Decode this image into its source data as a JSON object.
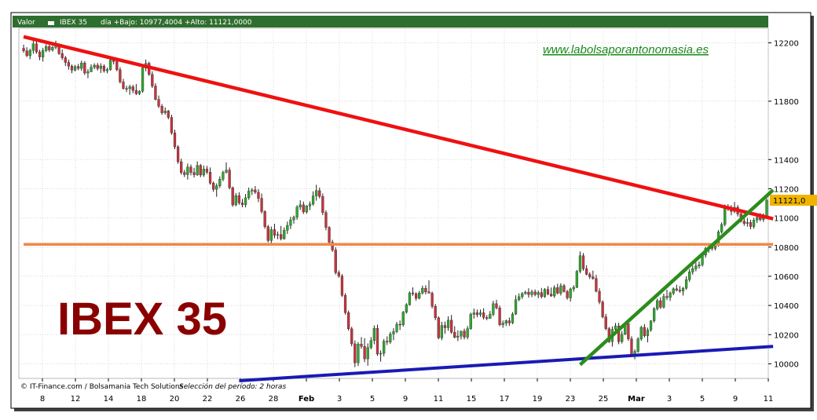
{
  "header": {
    "symbol_label": "Valor",
    "symbol": "IBEX 35",
    "ohlc_text": "día +Bajo: 10977,4004 +Alto: 11121,0000"
  },
  "watermark": "www.labolsaporantonomasia.es",
  "big_title": "IBEX 35",
  "footer": {
    "credit": "© IT-Finance.com / Bolsamania Tech Solutions",
    "period": "Selección del período: 2 horas"
  },
  "colors": {
    "header_bg": "#2e6e2e",
    "up": "#2fa82f",
    "down": "#c8323c",
    "resistance": "#ee1111",
    "support_h": "#f08848",
    "support_low": "#1a1ab4",
    "uptrend": "#2c8c1c",
    "last_tag": "#f0b400"
  },
  "chart_data": {
    "type": "candlestick",
    "ylim": [
      9900,
      12300
    ],
    "y_ticks": [
      10000,
      10200,
      10400,
      10600,
      10800,
      11000,
      11200,
      11400,
      11800,
      12200
    ],
    "x_tick_labels": [
      "8",
      "12",
      "14",
      "18",
      "20",
      "22",
      "26",
      "28",
      "Feb",
      "3",
      "5",
      "9",
      "11",
      "15",
      "17",
      "19",
      "23",
      "25",
      "Mar",
      "3",
      "5",
      "9",
      "11"
    ],
    "last_price_label": "11121,0",
    "last_value": 11121,
    "grid": true,
    "legend": "none",
    "ohlc": [
      [
        12163,
        12188,
        12132,
        12145
      ],
      [
        12145,
        12170,
        12102,
        12112
      ],
      [
        12112,
        12160,
        12088,
        12148
      ],
      [
        12148,
        12214,
        12125,
        12193
      ],
      [
        12193,
        12212,
        12126,
        12138
      ],
      [
        12138,
        12152,
        12081,
        12103
      ],
      [
        12103,
        12165,
        12072,
        12147
      ],
      [
        12147,
        12191,
        12136,
        12175
      ],
      [
        12175,
        12200,
        12137,
        12151
      ],
      [
        12151,
        12180,
        12140,
        12169
      ],
      [
        12169,
        12215,
        12156,
        12181
      ],
      [
        12181,
        12196,
        12117,
        12127
      ],
      [
        12127,
        12154,
        12083,
        12098
      ],
      [
        12098,
        12111,
        12042,
        12066
      ],
      [
        12066,
        12085,
        12016,
        12040
      ],
      [
        12040,
        12052,
        11992,
        12013
      ],
      [
        12013,
        12049,
        12005,
        12038
      ],
      [
        12038,
        12056,
        12012,
        12025
      ],
      [
        12025,
        12078,
        12008,
        12062
      ],
      [
        12062,
        12075,
        11980,
        11993
      ],
      [
        11993,
        12020,
        11958,
        12002
      ],
      [
        12002,
        12053,
        11999,
        12033
      ],
      [
        12033,
        12060,
        12020,
        12047
      ],
      [
        12047,
        12062,
        12010,
        12024
      ],
      [
        12024,
        12060,
        11993,
        12041
      ],
      [
        12041,
        12052,
        11996,
        12008
      ],
      [
        12008,
        12030,
        11991,
        12017
      ],
      [
        12017,
        12106,
        12008,
        12082
      ],
      [
        12082,
        12101,
        12052,
        12072
      ],
      [
        12072,
        12093,
        12005,
        12016
      ],
      [
        12016,
        12033,
        11922,
        11932
      ],
      [
        11932,
        11953,
        11880,
        11887
      ],
      [
        11887,
        11906,
        11863,
        11886
      ],
      [
        11886,
        11913,
        11844,
        11899
      ],
      [
        11899,
        11912,
        11855,
        11874
      ],
      [
        11874,
        11918,
        11842,
        11851
      ],
      [
        11851,
        11876,
        11842,
        11869
      ],
      [
        11869,
        12036,
        11858,
        12028
      ],
      [
        12028,
        12086,
        12005,
        12060
      ],
      [
        12060,
        12071,
        11974,
        11984
      ],
      [
        11984,
        12005,
        11891,
        11904
      ],
      [
        11904,
        11923,
        11806,
        11812
      ],
      [
        11812,
        11839,
        11753,
        11766
      ],
      [
        11766,
        11781,
        11706,
        11721
      ],
      [
        11721,
        11757,
        11708,
        11733
      ],
      [
        11733,
        11740,
        11676,
        11689
      ],
      [
        11689,
        11707,
        11570,
        11583
      ],
      [
        11583,
        11605,
        11471,
        11487
      ],
      [
        11487,
        11499,
        11371,
        11385
      ],
      [
        11385,
        11406,
        11296,
        11311
      ],
      [
        11311,
        11329,
        11280,
        11297
      ],
      [
        11297,
        11373,
        11263,
        11349
      ],
      [
        11349,
        11366,
        11292,
        11312
      ],
      [
        11312,
        11343,
        11277,
        11296
      ],
      [
        11296,
        11387,
        11288,
        11360
      ],
      [
        11360,
        11370,
        11279,
        11294
      ],
      [
        11294,
        11359,
        11281,
        11335
      ],
      [
        11335,
        11356,
        11301,
        11314
      ],
      [
        11314,
        11346,
        11228,
        11239
      ],
      [
        11239,
        11250,
        11179,
        11196
      ],
      [
        11196,
        11237,
        11145,
        11220
      ],
      [
        11220,
        11285,
        11206,
        11266
      ],
      [
        11266,
        11324,
        11251,
        11312
      ],
      [
        11312,
        11381,
        11305,
        11328
      ],
      [
        11328,
        11346,
        11196,
        11207
      ],
      [
        11207,
        11215,
        11076,
        11089
      ],
      [
        11089,
        11171,
        11080,
        11153
      ],
      [
        11153,
        11176,
        11090,
        11103
      ],
      [
        11103,
        11130,
        11073,
        11090
      ],
      [
        11090,
        11164,
        11072,
        11138
      ],
      [
        11138,
        11208,
        11124,
        11184
      ],
      [
        11184,
        11204,
        11157,
        11192
      ],
      [
        11192,
        11218,
        11164,
        11176
      ],
      [
        11176,
        11197,
        11108,
        11134
      ],
      [
        11134,
        11167,
        11030,
        11044
      ],
      [
        11044,
        11052,
        10926,
        10940
      ],
      [
        10940,
        10952,
        10832,
        10845
      ],
      [
        10845,
        10941,
        10828,
        10920
      ],
      [
        10920,
        10960,
        10861,
        10881
      ],
      [
        10881,
        10907,
        10854,
        10886
      ],
      [
        10886,
        10945,
        10846,
        10857
      ],
      [
        10857,
        10935,
        10851,
        10915
      ],
      [
        10915,
        10975,
        10890,
        10949
      ],
      [
        10949,
        11008,
        10924,
        10987
      ],
      [
        10987,
        11016,
        10961,
        11005
      ],
      [
        11005,
        11087,
        10987,
        11074
      ],
      [
        11074,
        11121,
        11054,
        11090
      ],
      [
        11090,
        11112,
        11027,
        11041
      ],
      [
        11041,
        11087,
        11029,
        11082
      ],
      [
        11082,
        11113,
        11053,
        11095
      ],
      [
        11095,
        11182,
        11084,
        11151
      ],
      [
        11151,
        11227,
        11118,
        11187
      ],
      [
        11187,
        11208,
        11134,
        11147
      ],
      [
        11147,
        11167,
        11019,
        11037
      ],
      [
        11037,
        11052,
        10915,
        10935
      ],
      [
        10935,
        10944,
        10820,
        10833
      ],
      [
        10833,
        10850,
        10767,
        10780
      ],
      [
        10780,
        10799,
        10612,
        10625
      ],
      [
        10625,
        10640,
        10590,
        10602
      ],
      [
        10602,
        10615,
        10458,
        10469
      ],
      [
        10469,
        10484,
        10337,
        10351
      ],
      [
        10351,
        10365,
        10227,
        10240
      ],
      [
        10240,
        10254,
        10120,
        10137
      ],
      [
        10137,
        10160,
        9977,
        10007
      ],
      [
        10007,
        10149,
        9985,
        10135
      ],
      [
        10135,
        10183,
        10103,
        10119
      ],
      [
        10119,
        10176,
        10011,
        10034
      ],
      [
        10034,
        10140,
        9987,
        10111
      ],
      [
        10111,
        10183,
        10099,
        10159
      ],
      [
        10159,
        10263,
        10134,
        10243
      ],
      [
        10243,
        10269,
        10054,
        10067
      ],
      [
        10067,
        10092,
        10015,
        10072
      ],
      [
        10072,
        10170,
        10051,
        10155
      ],
      [
        10155,
        10188,
        10129,
        10150
      ],
      [
        10150,
        10219,
        10137,
        10204
      ],
      [
        10204,
        10244,
        10162,
        10221
      ],
      [
        10221,
        10287,
        10210,
        10271
      ],
      [
        10271,
        10297,
        10232,
        10267
      ],
      [
        10267,
        10362,
        10255,
        10354
      ],
      [
        10354,
        10416,
        10344,
        10405
      ],
      [
        10405,
        10496,
        10399,
        10486
      ],
      [
        10486,
        10524,
        10466,
        10480
      ],
      [
        10480,
        10491,
        10433,
        10449
      ],
      [
        10449,
        10500,
        10442,
        10485
      ],
      [
        10485,
        10536,
        10475,
        10518
      ],
      [
        10518,
        10539,
        10476,
        10493
      ],
      [
        10493,
        10572,
        10482,
        10484
      ],
      [
        10484,
        10495,
        10380,
        10394
      ],
      [
        10394,
        10410,
        10299,
        10315
      ],
      [
        10315,
        10325,
        10169,
        10178
      ],
      [
        10178,
        10288,
        10162,
        10263
      ],
      [
        10263,
        10289,
        10206,
        10247
      ],
      [
        10247,
        10326,
        10227,
        10299
      ],
      [
        10299,
        10335,
        10205,
        10216
      ],
      [
        10216,
        10258,
        10174,
        10182
      ],
      [
        10182,
        10229,
        10156,
        10190
      ],
      [
        10190,
        10227,
        10167,
        10224
      ],
      [
        10224,
        10241,
        10167,
        10183
      ],
      [
        10183,
        10259,
        10168,
        10241
      ],
      [
        10241,
        10351,
        10234,
        10339
      ],
      [
        10339,
        10378,
        10310,
        10350
      ],
      [
        10350,
        10372,
        10319,
        10337
      ],
      [
        10337,
        10372,
        10322,
        10350
      ],
      [
        10350,
        10381,
        10303,
        10317
      ],
      [
        10317,
        10334,
        10299,
        10311
      ],
      [
        10311,
        10362,
        10309,
        10339
      ],
      [
        10339,
        10432,
        10326,
        10412
      ],
      [
        10412,
        10439,
        10373,
        10383
      ],
      [
        10383,
        10399,
        10258,
        10268
      ],
      [
        10268,
        10297,
        10247,
        10278
      ],
      [
        10278,
        10303,
        10259,
        10295
      ],
      [
        10295,
        10317,
        10260,
        10280
      ],
      [
        10280,
        10354,
        10272,
        10341
      ],
      [
        10341,
        10470,
        10334,
        10440
      ],
      [
        10440,
        10483,
        10429,
        10460
      ],
      [
        10460,
        10492,
        10445,
        10481
      ],
      [
        10481,
        10502,
        10474,
        10491
      ],
      [
        10491,
        10518,
        10453,
        10474
      ],
      [
        10474,
        10508,
        10457,
        10493
      ],
      [
        10493,
        10510,
        10463,
        10475
      ],
      [
        10475,
        10502,
        10450,
        10488
      ],
      [
        10488,
        10520,
        10449,
        10460
      ],
      [
        10460,
        10519,
        10452,
        10510
      ],
      [
        10510,
        10532,
        10470,
        10478
      ],
      [
        10478,
        10523,
        10459,
        10465
      ],
      [
        10465,
        10538,
        10452,
        10522
      ],
      [
        10522,
        10549,
        10476,
        10484
      ],
      [
        10484,
        10552,
        10468,
        10535
      ],
      [
        10535,
        10547,
        10489,
        10495
      ],
      [
        10495,
        10507,
        10439,
        10452
      ],
      [
        10452,
        10522,
        10427,
        10513
      ],
      [
        10513,
        10539,
        10494,
        10524
      ],
      [
        10524,
        10643,
        10519,
        10634
      ],
      [
        10634,
        10770,
        10620,
        10741
      ],
      [
        10741,
        10759,
        10638,
        10651
      ],
      [
        10651,
        10675,
        10607,
        10613
      ],
      [
        10613,
        10627,
        10581,
        10596
      ],
      [
        10596,
        10639,
        10576,
        10585
      ],
      [
        10585,
        10610,
        10490,
        10497
      ],
      [
        10497,
        10518,
        10409,
        10424
      ],
      [
        10424,
        10435,
        10312,
        10322
      ],
      [
        10322,
        10342,
        10230,
        10241
      ],
      [
        10241,
        10253,
        10142,
        10152
      ],
      [
        10152,
        10256,
        10118,
        10236
      ],
      [
        10236,
        10280,
        10217,
        10260
      ],
      [
        10260,
        10281,
        10134,
        10152
      ],
      [
        10152,
        10225,
        10139,
        10203
      ],
      [
        10203,
        10287,
        10196,
        10276
      ],
      [
        10276,
        10290,
        10157,
        10171
      ],
      [
        10171,
        10189,
        10049,
        10062
      ],
      [
        10062,
        10099,
        10031,
        10085
      ],
      [
        10085,
        10182,
        10075,
        10170
      ],
      [
        10170,
        10261,
        10157,
        10250
      ],
      [
        10250,
        10272,
        10180,
        10192
      ],
      [
        10192,
        10248,
        10147,
        10232
      ],
      [
        10232,
        10299,
        10220,
        10294
      ],
      [
        10294,
        10389,
        10282,
        10378
      ],
      [
        10378,
        10447,
        10365,
        10433
      ],
      [
        10433,
        10456,
        10376,
        10388
      ],
      [
        10388,
        10481,
        10378,
        10462
      ],
      [
        10462,
        10508,
        10437,
        10454
      ],
      [
        10454,
        10496,
        10431,
        10484
      ],
      [
        10484,
        10524,
        10470,
        10514
      ],
      [
        10514,
        10542,
        10496,
        10505
      ],
      [
        10505,
        10533,
        10487,
        10498
      ],
      [
        10498,
        10527,
        10468,
        10518
      ],
      [
        10518,
        10600,
        10508,
        10577
      ],
      [
        10577,
        10649,
        10561,
        10630
      ],
      [
        10630,
        10674,
        10611,
        10652
      ],
      [
        10652,
        10695,
        10634,
        10671
      ],
      [
        10671,
        10701,
        10653,
        10679
      ],
      [
        10679,
        10755,
        10666,
        10745
      ],
      [
        10745,
        10803,
        10727,
        10791
      ],
      [
        10791,
        10815,
        10761,
        10802
      ],
      [
        10802,
        10823,
        10775,
        10791
      ],
      [
        10791,
        10831,
        10777,
        10813
      ],
      [
        10813,
        10917,
        10803,
        10904
      ],
      [
        10904,
        10970,
        10893,
        10955
      ],
      [
        10955,
        11092,
        10942,
        11070
      ],
      [
        11070,
        11094,
        11048,
        11072
      ],
      [
        11072,
        11088,
        11018,
        11044
      ],
      [
        11044,
        11109,
        11032,
        11073
      ],
      [
        11073,
        11088,
        11010,
        11027
      ],
      [
        11027,
        11045,
        10969,
        10978
      ],
      [
        10978,
        11001,
        10946,
        10962
      ],
      [
        10962,
        11000,
        10940,
        10969
      ],
      [
        10969,
        10987,
        10922,
        10941
      ],
      [
        10941,
        11001,
        10926,
        10985
      ],
      [
        10985,
        11020,
        10965,
        11004
      ],
      [
        11004,
        11033,
        10977,
        10989
      ],
      [
        10989,
        11031,
        10973,
        11006
      ],
      [
        11006,
        11133,
        10994,
        11121
      ]
    ],
    "trend_lines": [
      {
        "name": "resistance",
        "points": [
          [
            0,
            12242
          ],
          [
            233,
            10994
          ]
        ]
      },
      {
        "name": "horizontal-support",
        "points": [
          [
            0,
            10819
          ],
          [
            233,
            10819
          ]
        ]
      },
      {
        "name": "long-term-support",
        "points": [
          [
            67,
            9884
          ],
          [
            233,
            10119
          ]
        ]
      },
      {
        "name": "uptrend",
        "points": [
          [
            173,
            9994
          ],
          [
            233,
            11191
          ]
        ]
      }
    ]
  }
}
